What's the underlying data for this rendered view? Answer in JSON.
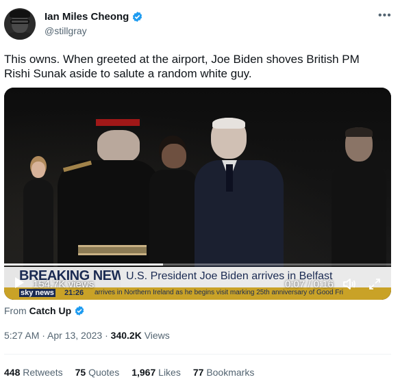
{
  "author": {
    "name": "Ian Miles Cheong",
    "handle": "@stillgray",
    "verified": true,
    "verified_color": "#1d9bf0"
  },
  "menu_icon": "more-horizontal-icon",
  "tweet_text": "This owns. When greeted at the airport, Joe Biden shoves British PM Rishi Sunak aside to salute a random white guy.",
  "video": {
    "banner_title": "BREAKING NEWS",
    "banner_headline": "U.S. President Joe Biden arrives in Belfast",
    "ticker_logo": "sky news",
    "ticker_time": "21:26",
    "ticker_text": "arrives in Northern Ireland as he begins visit marking 25th anniversary of Good Fri",
    "views": "154.7K views",
    "time_display": "0:07 / 0:16",
    "progress": 0.41,
    "controls": [
      "play-icon",
      "volume-icon",
      "fullscreen-icon"
    ]
  },
  "source": {
    "prefix": "From",
    "name": "Catch Up",
    "verified": true
  },
  "meta": {
    "timestamp": "5:27 AM · Apr 13, 2023 · ",
    "views_count": "340.2K",
    "views_label": " Views"
  },
  "stats": [
    {
      "count": "448",
      "label": "Retweets"
    },
    {
      "count": "75",
      "label": "Quotes"
    },
    {
      "count": "1,967",
      "label": "Likes"
    },
    {
      "count": "77",
      "label": "Bookmarks"
    }
  ]
}
